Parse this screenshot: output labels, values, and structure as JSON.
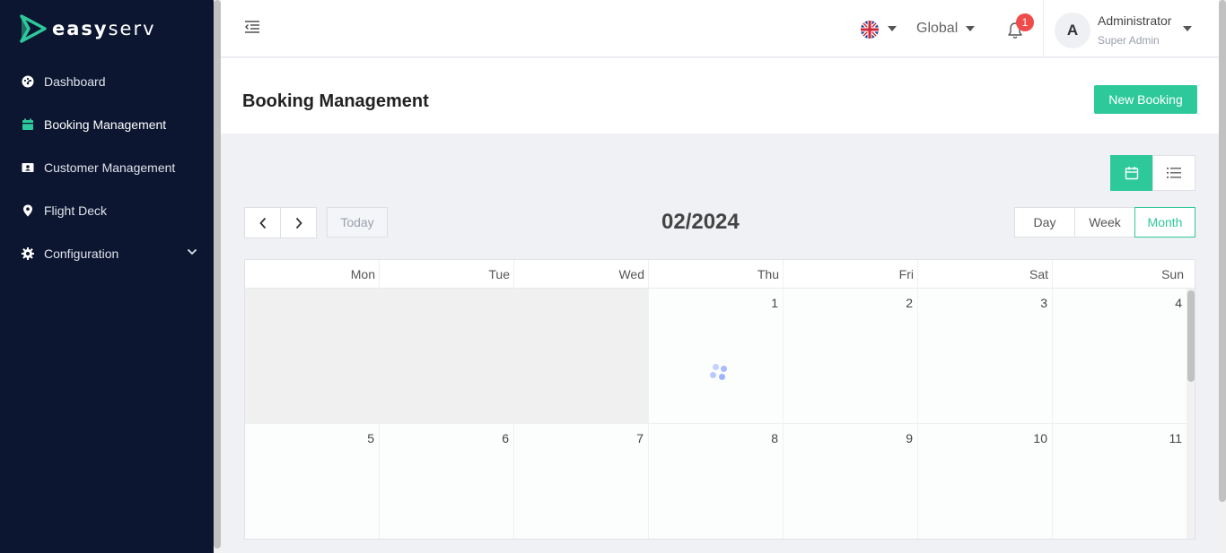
{
  "brand": {
    "logo_text_bold": "easy",
    "logo_text_light": "serv",
    "accent": "#2ec99a",
    "sidebar_bg": "#0c1630"
  },
  "sidebar": {
    "items": [
      {
        "label": "Dashboard",
        "icon": "dashboard-icon"
      },
      {
        "label": "Booking Management",
        "icon": "calendar-icon",
        "active": true
      },
      {
        "label": "Customer Management",
        "icon": "contact-card-icon"
      },
      {
        "label": "Flight Deck",
        "icon": "map-pin-icon"
      },
      {
        "label": "Configuration",
        "icon": "gear-icon",
        "expandable": true
      }
    ]
  },
  "header": {
    "language_flag": "uk-flag-icon",
    "region": "Global",
    "notifications_count": "1",
    "user": {
      "initial": "A",
      "name": "Administrator",
      "role": "Super Admin"
    }
  },
  "page": {
    "title": "Booking Management",
    "new_button": "New Booking"
  },
  "calendar": {
    "title": "02/2024",
    "today_label": "Today",
    "views": {
      "day": "Day",
      "week": "Week",
      "month": "Month",
      "active": "Month"
    },
    "weekdays": [
      "Mon",
      "Tue",
      "Wed",
      "Thu",
      "Fri",
      "Sat",
      "Sun"
    ],
    "weeks": [
      [
        "",
        "",
        "",
        "1",
        "2",
        "3",
        "4"
      ],
      [
        "5",
        "6",
        "7",
        "8",
        "9",
        "10",
        "11"
      ]
    ],
    "loading": true
  }
}
